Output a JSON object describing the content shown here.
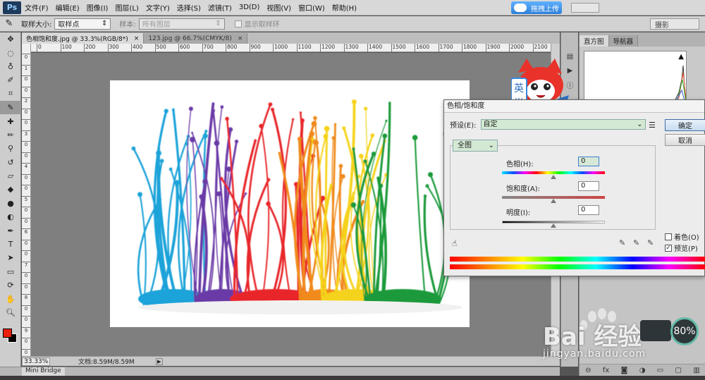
{
  "menubar": {
    "logo": "Ps",
    "items": [
      "文件(F)",
      "编辑(E)",
      "图像(I)",
      "图层(L)",
      "文字(Y)",
      "选择(S)",
      "滤镜(T)",
      "3D(D)",
      "视图(V)",
      "窗口(W)",
      "帮助(H)"
    ],
    "upload_label": "拖拽上传"
  },
  "options": {
    "sample_size_label": "取样大小:",
    "sample_size_value": "取样点",
    "sample_label": "样本:",
    "sample_value": "所有图层",
    "show_ring_label": "显示取样环",
    "workspace": "摄影"
  },
  "document": {
    "tabs": [
      {
        "label": "色相饱和度.jpg @ 33.3%(RGB/8*)",
        "close": "×"
      },
      {
        "label": "123.jpg @ 66.7%(CMYK/8)",
        "close": "×"
      }
    ],
    "ruler_h": [
      "0",
      "100",
      "200",
      "300",
      "400",
      "500",
      "600",
      "700",
      "800",
      "900",
      "1000",
      "1100",
      "1200",
      "1300",
      "1400",
      "1500",
      "1600",
      "1700",
      "1800",
      "1900",
      "2000",
      "2100"
    ],
    "ruler_v": [
      "0",
      "1",
      "0",
      "0",
      "2",
      "0",
      "0",
      "3",
      "0",
      "0",
      "4",
      "0",
      "0",
      "5",
      "0",
      "0",
      "6",
      "0",
      "0",
      "7",
      "0",
      "0",
      "8",
      "0",
      "0",
      "9",
      "0",
      "0"
    ],
    "zoom": "33.33%",
    "doc_size": "文档:8.59M/8.59M"
  },
  "mini_bridge": "Mini Bridge",
  "panels": {
    "tabs": [
      "直方图",
      "导航器"
    ],
    "warning": "▲"
  },
  "dialog": {
    "title": "色相/饱和度",
    "preset_label": "预设(E):",
    "preset_value": "自定",
    "ok": "确定",
    "cancel": "取消",
    "channel": "全图",
    "hue_label": "色相(H):",
    "hue_value": "0",
    "saturation_label": "饱和度(A):",
    "saturation_value": "0",
    "lightness_label": "明度(I):",
    "lightness_value": "0",
    "colorize_label": "着色(O)",
    "colorize_checked": false,
    "preview_label": "预览(P)",
    "preview_checked": true
  },
  "mascot_chars": [
    "英",
    "半"
  ],
  "watermark": {
    "brand": "Bai 经验",
    "url": "jingyan.baidu.com"
  },
  "zoom_badge": "80%",
  "colors": {
    "foreground": "#e8200c",
    "background": "#000000",
    "accent": "#2f7fd6"
  }
}
